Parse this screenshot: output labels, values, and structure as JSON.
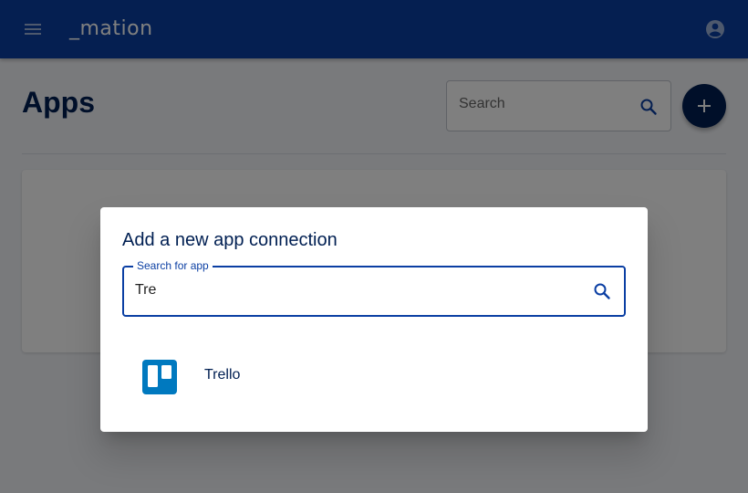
{
  "appbar": {
    "logo_text": "_mation",
    "menu_icon": "menu-icon",
    "account_icon": "account-circle-icon",
    "color": "#0b3fa3"
  },
  "main": {
    "title": "Apps",
    "search": {
      "placeholder": "Search",
      "icon": "search-icon"
    },
    "add_button_icon": "plus-icon",
    "title_color": "#001f52"
  },
  "dialog": {
    "title": "Add a new app connection",
    "search_label": "Search for app",
    "search_value": "Tre",
    "search_icon": "search-icon",
    "results": [
      {
        "name": "Trello",
        "icon": "trello-icon",
        "icon_color": "#0079bf"
      }
    ]
  }
}
